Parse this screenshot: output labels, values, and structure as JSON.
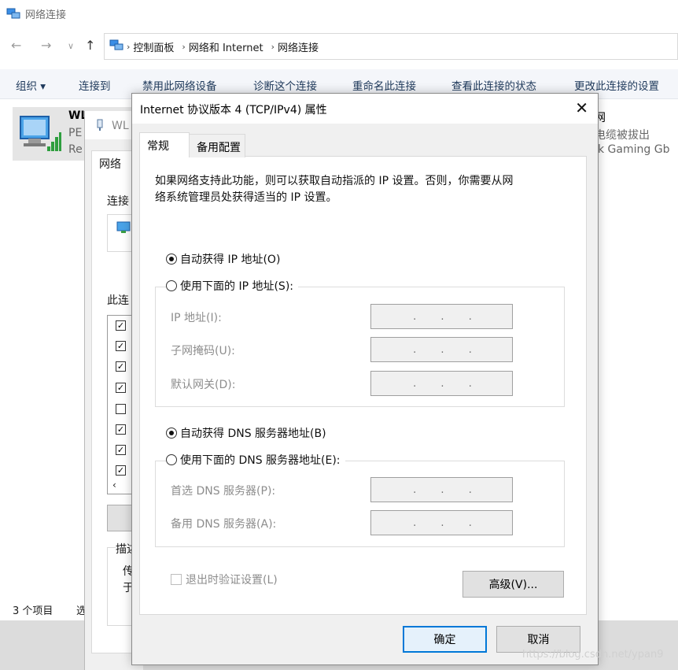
{
  "explorer": {
    "title": "网络连接",
    "breadcrumb": [
      "控制面板",
      "网络和 Internet",
      "网络连接"
    ],
    "commands": [
      "组织 ▾",
      "连接到",
      "禁用此网络设备",
      "诊断这个连接",
      "重命名此连接",
      "查看此连接的状态",
      "更改此连接的设置"
    ],
    "connection1": {
      "name": "WL",
      "line2": "PE",
      "line3": "Re"
    },
    "connection2": {
      "name": "太网",
      "line2": "络电缆被拔出",
      "line3": "ltek Gaming Gb"
    },
    "status": "3 个项目",
    "status2": "选"
  },
  "back_dialog": {
    "title": "WL",
    "tab": "网络",
    "connect_label": "连接",
    "items_label": "此连",
    "desc_label": "描述",
    "desc_line1": "传",
    "desc_line2": "于",
    "items_checked": [
      true,
      true,
      true,
      true,
      false,
      true,
      true,
      true
    ]
  },
  "dialog": {
    "title": "Internet 协议版本 4 (TCP/IPv4) 属性",
    "close_glyph": "✕",
    "tabs": [
      "常规",
      "备用配置"
    ],
    "intro_line1": "如果网络支持此功能，则可以获取自动指派的 IP 设置。否则，你需要从网",
    "intro_line2": "络系统管理员处获得适当的 IP 设置。",
    "ip_auto_label": "自动获得 IP 地址(O)",
    "ip_manual_label": "使用下面的 IP 地址(S):",
    "ip_auto_selected": true,
    "ip_fields": [
      {
        "label": "IP 地址(I):",
        "value": ""
      },
      {
        "label": "子网掩码(U):",
        "value": ""
      },
      {
        "label": "默认网关(D):",
        "value": ""
      }
    ],
    "dns_auto_label": "自动获得 DNS 服务器地址(B)",
    "dns_manual_label": "使用下面的 DNS 服务器地址(E):",
    "dns_auto_selected": true,
    "dns_fields": [
      {
        "label": "首选 DNS 服务器(P):",
        "value": ""
      },
      {
        "label": "备用 DNS 服务器(A):",
        "value": ""
      }
    ],
    "validate_label": "退出时验证设置(L)",
    "advanced_label": "高级(V)...",
    "ok_label": "确定",
    "cancel_label": "取消",
    "ip_dot": "."
  },
  "watermark": "https://blog.csdn.net/ypan9"
}
